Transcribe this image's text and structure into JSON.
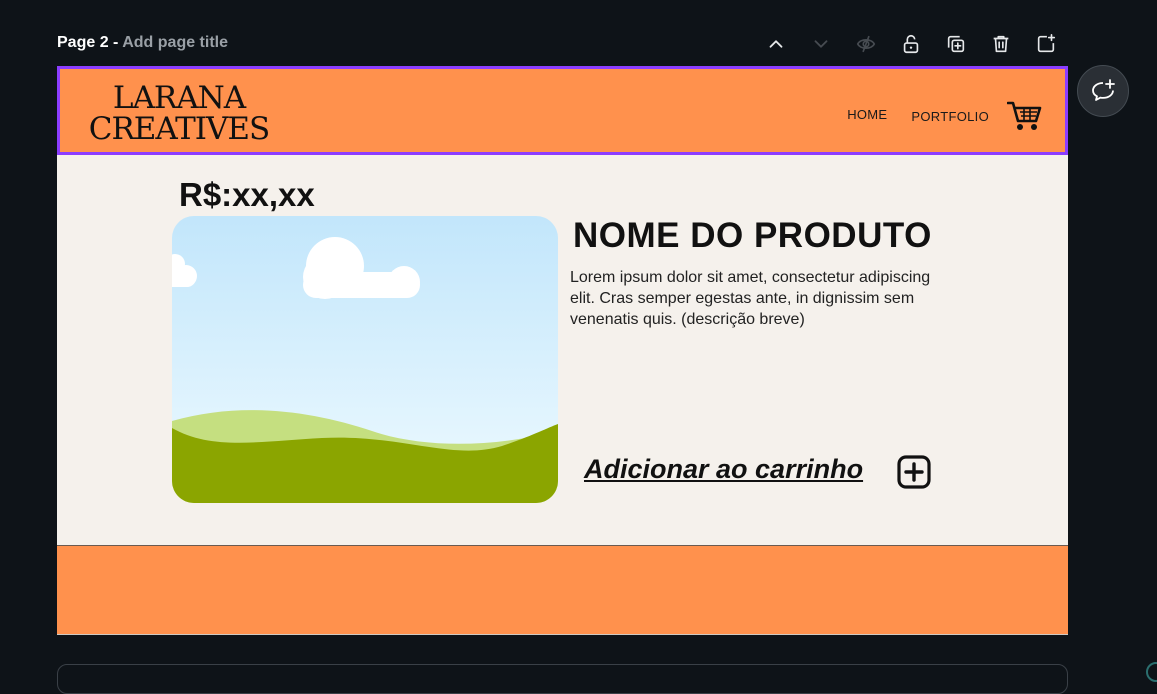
{
  "page_bar": {
    "page_label": "Page 2 - ",
    "title_placeholder": "Add page title"
  },
  "tools": [
    {
      "name": "move-up",
      "icon": "chevron-up-icon",
      "enabled": true
    },
    {
      "name": "move-down",
      "icon": "chevron-down-icon",
      "enabled": false
    },
    {
      "name": "hide-page",
      "icon": "eye-off-icon",
      "enabled": false
    },
    {
      "name": "lock-page",
      "icon": "lock-icon",
      "enabled": true
    },
    {
      "name": "duplicate-page",
      "icon": "duplicate-icon",
      "enabled": true
    },
    {
      "name": "delete-page",
      "icon": "trash-icon",
      "enabled": true
    },
    {
      "name": "add-page",
      "icon": "add-page-icon",
      "enabled": true
    }
  ],
  "design": {
    "header": {
      "logo_line1": "LARANA",
      "logo_line2": "CREATIVES",
      "nav": {
        "home": "HOME",
        "portfolio": "PORTFOLIO"
      },
      "cart_icon": "shopping-cart-icon"
    },
    "product": {
      "price": "R$:xx,xx",
      "name": "NOME DO PRODUTO",
      "description": "Lorem ipsum dolor sit amet, consectetur adipiscing elit. Cras semper egestas ante, in dignissim sem venenatis quis. (descrição breve)",
      "add_to_cart": "Adicionar ao carrinho",
      "add_icon": "plus-square-icon"
    }
  },
  "colors": {
    "accent_orange": "#ff914d",
    "selection_purple": "#8b3dff",
    "canvas_bg": "#f5f1ec",
    "app_bg": "#0e1318"
  },
  "comment_button_icon": "add-comment-icon"
}
